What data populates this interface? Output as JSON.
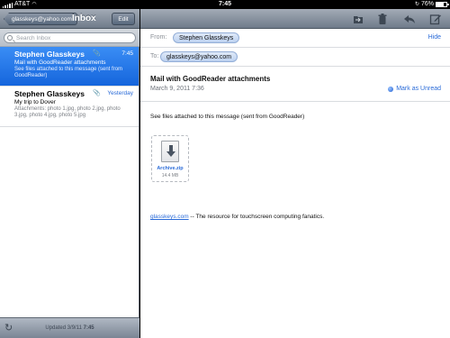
{
  "status_bar": {
    "carrier": "AT&T",
    "time": "7:45",
    "battery": "76%",
    "battery_level": 0.76
  },
  "sidebar": {
    "back_label": "glasskeys@yahoo.com",
    "title": "Inbox",
    "edit_label": "Edit",
    "search_placeholder": "Search Inbox",
    "messages": [
      {
        "sender": "Stephen Glasskeys",
        "time": "7:45",
        "subject": "Mail with GoodReader attachments",
        "preview": "See files attached to this message (sent from GoodReader)",
        "has_attachment": true,
        "selected": true
      },
      {
        "sender": "Stephen Glasskeys",
        "time": "Yesterday",
        "subject": "My trip to Dover",
        "preview": "Attachments: photo 1.jpg, photo 2.jpg, photo 3.jpg, photo 4.jpg, photo 5.jpg",
        "has_attachment": true,
        "selected": false
      }
    ],
    "updated_label": "Updated",
    "updated_date": "3/9/11",
    "updated_time": "7:45"
  },
  "toolbar": {
    "icons": [
      "folder-move-icon",
      "trash-icon",
      "reply-icon",
      "compose-icon"
    ]
  },
  "message": {
    "from_label": "From:",
    "from": "Stephen Glasskeys",
    "hide_label": "Hide",
    "to_label": "To:",
    "to": "glasskeys@yahoo.com",
    "subject": "Mail with GoodReader attachments",
    "date": "March 9, 2011 7:36",
    "mark_unread_label": "Mark as Unread",
    "body": "See files attached to this message (sent from GoodReader)",
    "attachment": {
      "name": "Archive.zip",
      "size": "14.4 MB"
    },
    "signature_link": "glasskeys.com",
    "signature_text": " -- The resource for touchscreen computing fanatics."
  },
  "colors": {
    "accent": "#2a6bd8",
    "selected_row": "#1f75ee",
    "toolbar": "#8a94a2"
  }
}
